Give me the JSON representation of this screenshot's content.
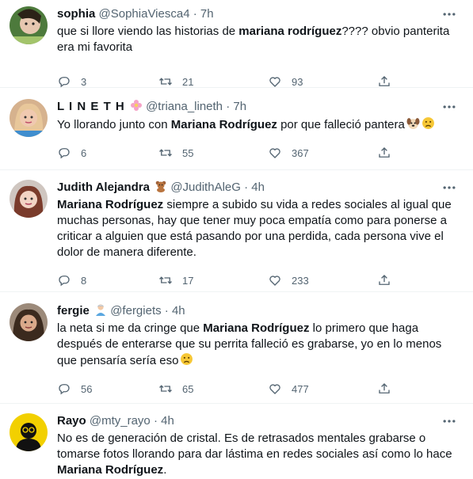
{
  "tweets": [
    {
      "name": "sophia",
      "name_emoji": "",
      "handle": "@SophiaViesca4",
      "sep": "·",
      "time": "7h",
      "text_parts": [
        {
          "t": "que si llore viendo las historias de ",
          "b": false
        },
        {
          "t": "mariana rodríguez",
          "b": true
        },
        {
          "t": "???? obvio panterita era mi favorita",
          "b": false
        }
      ],
      "replies": "3",
      "retweets": "21",
      "likes": "93",
      "avatar_color": "#3e6b3a"
    },
    {
      "name": "L I N E T H",
      "name_emoji": "flower-emoji",
      "handle": "@triana_lineth",
      "sep": "·",
      "time": "7h",
      "text_parts": [
        {
          "t": "Yo llorando junto con ",
          "b": false
        },
        {
          "t": "Mariana Rodríguez",
          "b": true
        },
        {
          "t": " por que falleció pantera",
          "b": false
        }
      ],
      "trailing_emojis": [
        "dog-face-emoji",
        "frowning-face-emoji"
      ],
      "replies": "6",
      "retweets": "55",
      "likes": "367",
      "avatar_color": "#c9a27a"
    },
    {
      "name": "Judith Alejandra",
      "name_emoji": "teddy-bear-emoji",
      "handle": "@JudithAleG",
      "sep": "·",
      "time": "4h",
      "text_parts": [
        {
          "t": "Mariana Rodríguez",
          "b": true
        },
        {
          "t": " siempre a subido su vida a redes sociales al igual que muchas personas, hay que tener muy poca empatía como para ponerse a criticar a alguien que está pasando por una perdida, cada persona vive el dolor de manera diferente.",
          "b": false
        }
      ],
      "replies": "8",
      "retweets": "17",
      "likes": "233",
      "avatar_color": "#8a6a5e"
    },
    {
      "name": "fergie",
      "name_emoji": "person-emoji",
      "handle": "@fergiets",
      "sep": "·",
      "time": "4h",
      "text_parts": [
        {
          "t": "la neta si me da cringe que ",
          "b": false
        },
        {
          "t": "Mariana Rodríguez",
          "b": true
        },
        {
          "t": " lo primero que haga después de enterarse que su perrita falleció es grabarse, yo en lo menos que pensaría sería eso",
          "b": false
        }
      ],
      "trailing_emojis": [
        "frowning-face-emoji"
      ],
      "replies": "56",
      "retweets": "65",
      "likes": "477",
      "avatar_color": "#6d5647"
    },
    {
      "name": "Rayo",
      "name_emoji": "",
      "handle": "@mty_rayo",
      "sep": "·",
      "time": "4h",
      "text_parts": [
        {
          "t": "No es de generación de cristal. Es de retrasados mentales grabarse o tomarse fotos llorando para dar lástima en redes sociales así como lo hace ",
          "b": false
        },
        {
          "t": "Mariana Rodríguez",
          "b": true
        },
        {
          "t": ".",
          "b": false
        }
      ],
      "replies": "",
      "retweets": "",
      "likes": "",
      "avatar_color": "#f2d000"
    }
  ]
}
